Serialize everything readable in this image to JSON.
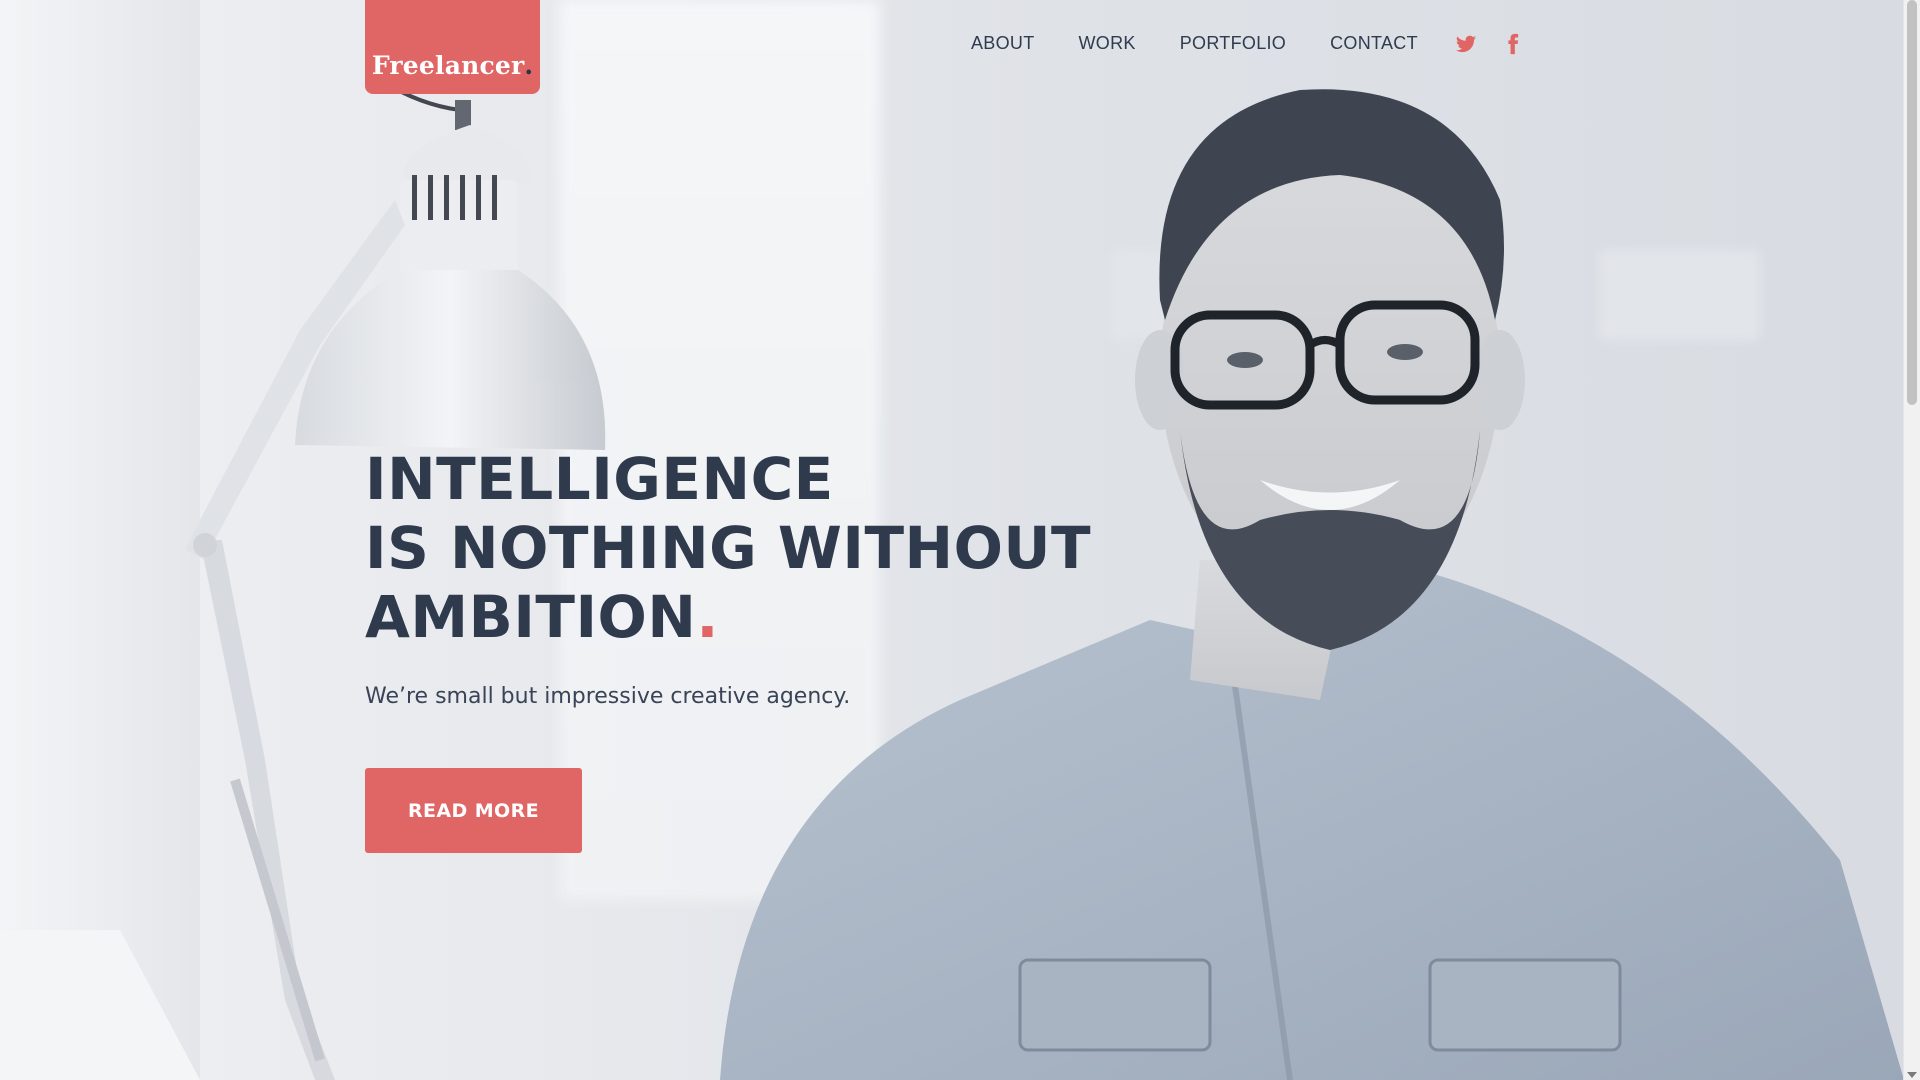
{
  "logo": {
    "text": "Freelancer",
    "dot": "."
  },
  "nav": {
    "items": [
      "ABOUT",
      "WORK",
      "PORTFOLIO",
      "CONTACT"
    ]
  },
  "social": {
    "icons": [
      "twitter-icon",
      "facebook-icon"
    ]
  },
  "hero": {
    "headline_lines": [
      "INTELLIGENCE",
      "IS NOTHING WITHOUT",
      "AMBITION"
    ],
    "headline_dot": ".",
    "tagline": "We’re small but impressive creative agency.",
    "cta_label": "READ MORE"
  },
  "colors": {
    "accent": "#e06666",
    "text_dark": "#2f3a4d",
    "background": "#e9ebee"
  }
}
